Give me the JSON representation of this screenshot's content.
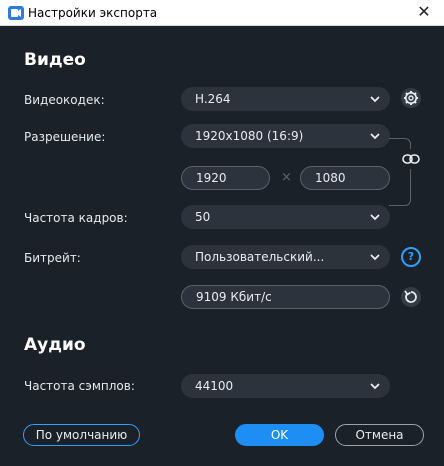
{
  "window": {
    "title": "Настройки экспорта",
    "close_glyph": "✕"
  },
  "video": {
    "section_title": "Видео",
    "codec": {
      "label": "Видеокодек:",
      "value": "H.264"
    },
    "resolution": {
      "label": "Разрешение:",
      "value": "1920x1080 (16:9)",
      "width": "1920",
      "times": "×",
      "height": "1080"
    },
    "framerate": {
      "label": "Частота кадров:",
      "value": "50"
    },
    "bitrate": {
      "label": "Битрейт:",
      "value": "Пользовательский...",
      "custom_value": "9109 Кбит/с",
      "help_glyph": "?"
    }
  },
  "audio": {
    "section_title": "Аудио",
    "samplerate": {
      "label": "Частота сэмплов:",
      "value": "44100"
    }
  },
  "footer": {
    "default_label": "По умолчанию",
    "ok_label": "OK",
    "cancel_label": "Отмена"
  },
  "colors": {
    "accent": "#1e8ef5",
    "background": "#1b2128",
    "field": "#2c333c"
  },
  "icons": [
    "app-icon",
    "close-icon",
    "chevron-down-icon",
    "gear-icon",
    "link-icon",
    "help-icon",
    "reset-icon"
  ]
}
